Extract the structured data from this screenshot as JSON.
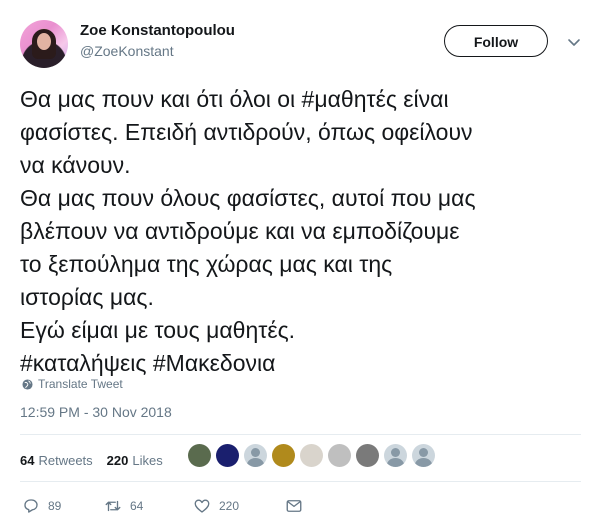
{
  "header": {
    "display_name": "Zoe Konstantopoulou",
    "handle": "@ZoeKonstant",
    "follow_label": "Follow"
  },
  "tweet": {
    "text": "Θα μας πουν και ότι όλοι οι #μαθητές είναι\nφασίστες. Επειδή αντιδρούν, όπως οφείλουν\nνα κάνουν.\nΘα μας πουν όλους φασίστες, αυτοί που μας\nβλέπουν να αντιδρούμε και να εμποδίζουμε\nτο ξεπούλημα της χώρας μας και της\nιστορίας μας.\nΕγώ είμαι με τους μαθητές.\n#καταλήψεις #Μακεδονια",
    "translate_label": "Translate Tweet",
    "timestamp": "12:59 PM - 30 Nov 2018"
  },
  "stats": {
    "retweets_count": "64",
    "retweets_label": "Retweets",
    "likes_count": "220",
    "likes_label": "Likes"
  },
  "likers": [
    {
      "color": "#5a6b4e",
      "icon": "avatar-photo"
    },
    {
      "color": "#1a1f6e",
      "icon": "avatar-photo"
    },
    {
      "color": "#ccd6dd",
      "icon": "default-avatar"
    },
    {
      "color": "#b08a1c",
      "icon": "avatar-photo"
    },
    {
      "color": "#d9d4cc",
      "icon": "avatar-photo"
    },
    {
      "color": "#bfbfbf",
      "icon": "avatar-photo"
    },
    {
      "color": "#7a7a7a",
      "icon": "avatar-photo"
    },
    {
      "color": "#ccd6dd",
      "icon": "default-avatar"
    },
    {
      "color": "#ccd6dd",
      "icon": "default-avatar"
    }
  ],
  "actions": {
    "replies": "89",
    "retweets": "64",
    "likes": "220"
  },
  "colors": {
    "text": "#14171a",
    "secondary": "#657786",
    "divider": "#e6ecf0"
  }
}
